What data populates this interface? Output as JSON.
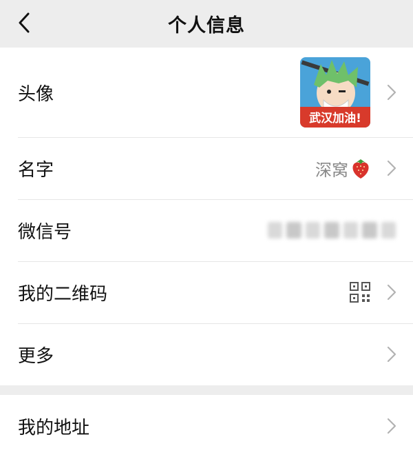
{
  "navbar": {
    "title": "个人信息"
  },
  "rows": {
    "avatar": {
      "label": "头像",
      "badge_text": "武汉加油!"
    },
    "name": {
      "label": "名字",
      "value": "深窝"
    },
    "wechat_id": {
      "label": "微信号"
    },
    "qr_code": {
      "label": "我的二维码"
    },
    "more": {
      "label": "更多"
    },
    "address": {
      "label": "我的地址"
    }
  },
  "colors": {
    "background": "#ededed",
    "card": "#ffffff",
    "chevron": "#b2b2b2",
    "avatar_bg": "#4aa3d9",
    "avatar_banner": "#d83a2b",
    "avatar_hair": "#6fc06a"
  },
  "icons": [
    "back-arrow-icon",
    "chevron-right-icon",
    "strawberry-emoji-icon",
    "qr-code-icon"
  ]
}
